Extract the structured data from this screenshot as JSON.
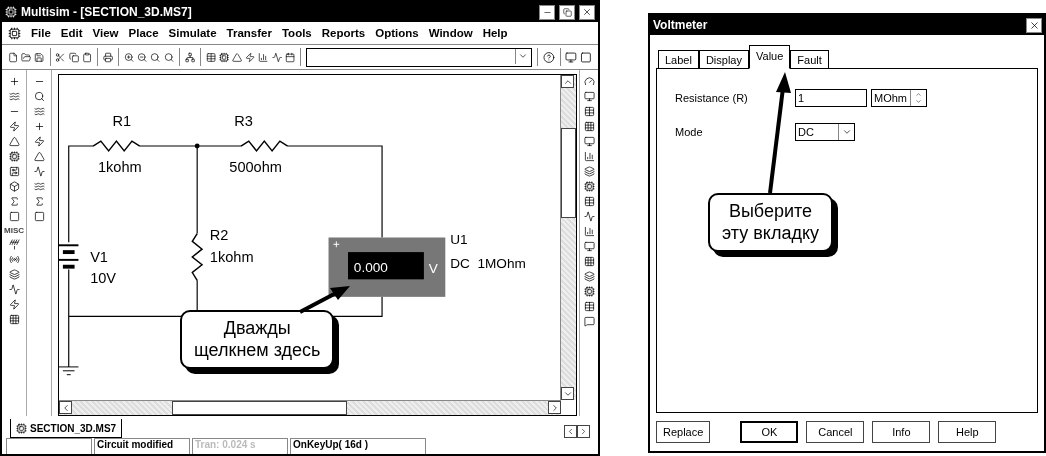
{
  "main_window": {
    "title": "Multisim - [SECTION_3D.MS7]",
    "menu": [
      {
        "label": "File"
      },
      {
        "label": "Edit"
      },
      {
        "label": "View"
      },
      {
        "label": "Place"
      },
      {
        "label": "Simulate"
      },
      {
        "label": "Transfer"
      },
      {
        "label": "Tools"
      },
      {
        "label": "Reports"
      },
      {
        "label": "Options"
      },
      {
        "label": "Window"
      },
      {
        "label": "Help"
      }
    ],
    "palette_label": "MISC",
    "circuit": {
      "components": [
        {
          "kind": "resistor",
          "ref": "R1",
          "value": "1kohm"
        },
        {
          "kind": "resistor",
          "ref": "R3",
          "value": "500ohm"
        },
        {
          "kind": "resistor",
          "ref": "R2",
          "value": "1kohm"
        },
        {
          "kind": "battery",
          "ref": "V1",
          "value": "10V"
        }
      ],
      "voltmeter": {
        "ref": "U1",
        "reading": "0.000",
        "unit": "V",
        "mode": "DC",
        "resistance": "1MOhm"
      }
    },
    "document_tab": "SECTION_3D.MS7",
    "status_bar": [
      {
        "text": "Circuit modified",
        "disabled": false
      },
      {
        "text": "Tran: 0.024 s",
        "disabled": true
      },
      {
        "text": "OnKeyUp( 16d )",
        "disabled": false
      }
    ]
  },
  "callouts": [
    {
      "lines": [
        "Дважды",
        "щелкнем здесь"
      ]
    },
    {
      "lines": [
        "Выберите",
        "эту вкладку"
      ]
    }
  ],
  "dialog": {
    "title": "Voltmeter",
    "tabs": [
      {
        "label": "Label",
        "selected": false
      },
      {
        "label": "Display",
        "selected": false
      },
      {
        "label": "Value",
        "selected": true
      },
      {
        "label": "Fault",
        "selected": false
      }
    ],
    "fields": [
      {
        "kind": "spin",
        "label": "Resistance (R)",
        "value": "1",
        "unit": "MOhm"
      },
      {
        "kind": "select",
        "label": "Mode",
        "value": "DC"
      }
    ],
    "buttons": [
      {
        "label": "Replace",
        "default": false
      },
      {
        "label": "OK",
        "default": true
      },
      {
        "label": "Cancel",
        "default": false
      },
      {
        "label": "Info",
        "default": false
      },
      {
        "label": "Help",
        "default": false
      }
    ]
  }
}
